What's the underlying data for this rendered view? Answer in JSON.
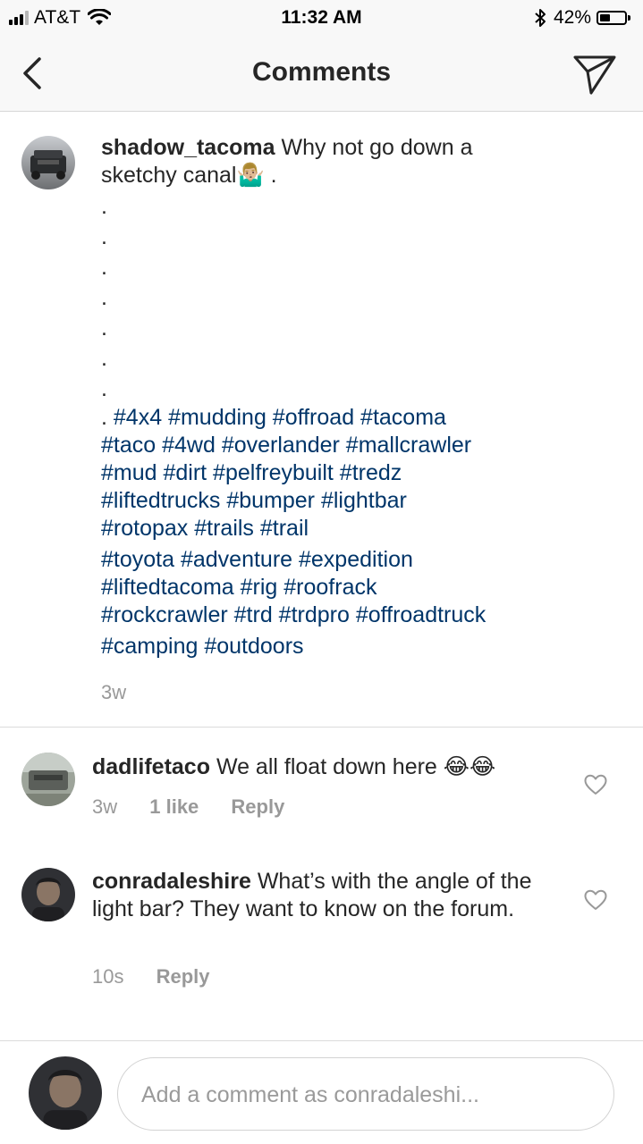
{
  "status_bar": {
    "carrier": "AT&T",
    "time": "11:32 AM",
    "battery_percent": "42%",
    "battery_level": 0.42,
    "icons": [
      "signal-icon",
      "wifi-icon",
      "bluetooth-icon",
      "battery-icon"
    ]
  },
  "header": {
    "title": "Comments",
    "back_icon": "chevron-left-icon",
    "send_icon": "paper-plane-icon"
  },
  "caption": {
    "username": "shadow_tacoma",
    "text_line1": "Why not go down a",
    "text_line2": "sketchy canal",
    "emoji": "🤷🏼‍♂️",
    "text_after_emoji": ".",
    "dots": [
      ".",
      ".",
      ".",
      ".",
      ".",
      ".",
      "."
    ],
    "hashtag_prefix": ".",
    "hashtag_lines": [
      "#4x4 #mudding #offroad #tacoma",
      "#taco #4wd #overlander #mallcrawler",
      "#mud #dirt #pelfreybuilt #tredz",
      "#liftedtrucks #bumper #lightbar",
      "#rotopax #trails #trail",
      "#toyota #adventure #expedition",
      "#liftedtacoma #rig #roofrack",
      "#rockcrawler #trd #trdpro #offroadtruck",
      "#camping #outdoors"
    ],
    "time": "3w"
  },
  "comments": [
    {
      "username": "dadlifetaco",
      "text": "We all float down here",
      "emoji": "😂😂",
      "time": "3w",
      "likes": "1 like",
      "reply": "Reply"
    },
    {
      "username": "conradaleshire",
      "text": "What’s with the angle of the light bar? They want to know on the forum.",
      "time": "10s",
      "reply": "Reply"
    }
  ],
  "composer": {
    "placeholder": "Add a comment as conradaleshi..."
  },
  "colors": {
    "hashtag": "#003569",
    "meta_gray": "#999999",
    "bar_bg": "#f8f8f8",
    "divider": "#dbdbdb"
  }
}
